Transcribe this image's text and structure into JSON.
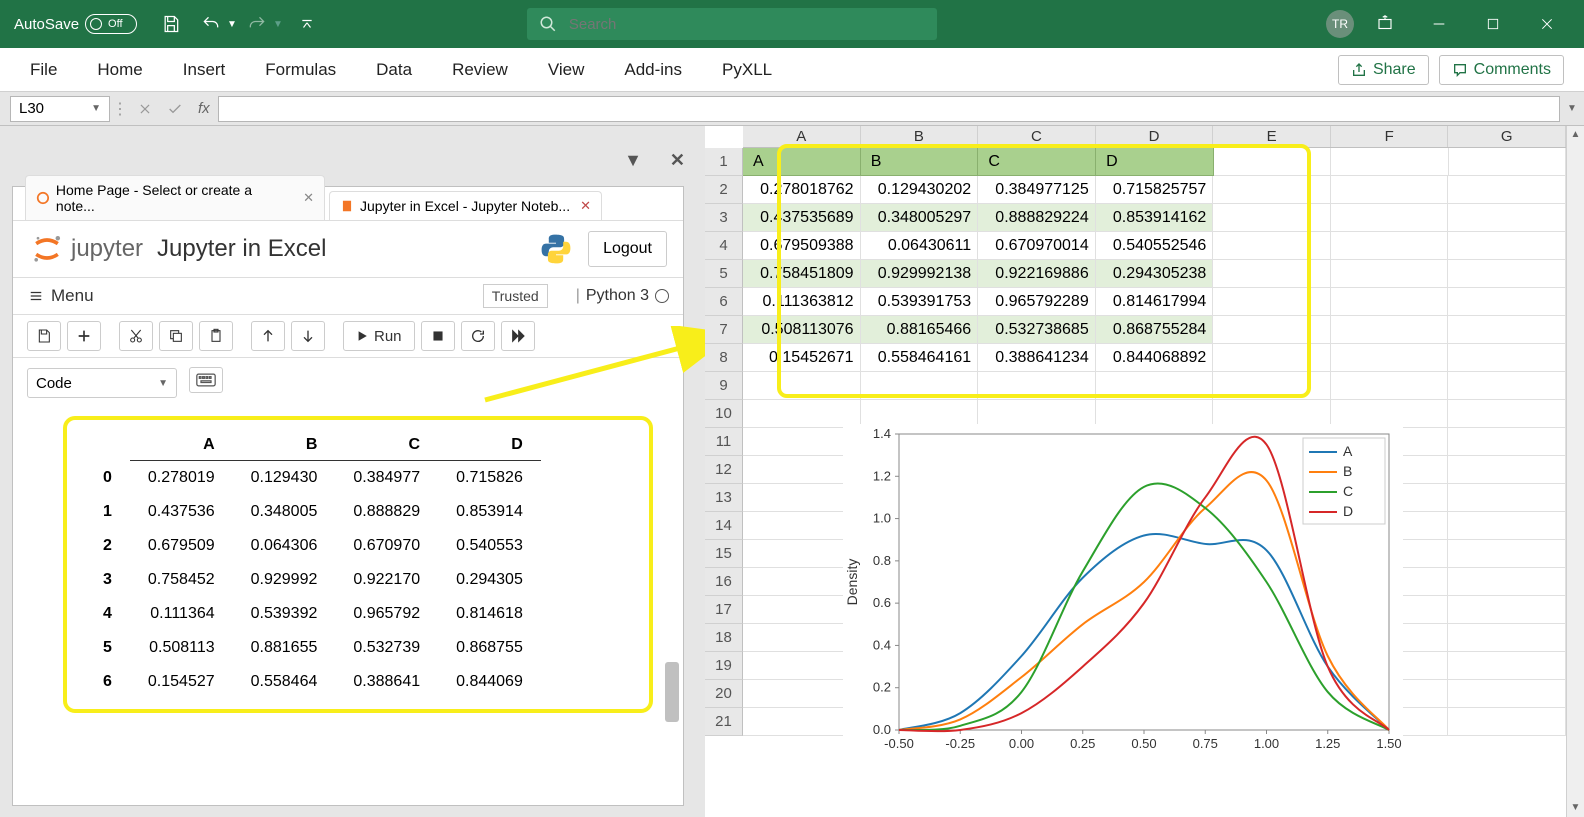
{
  "titlebar": {
    "autosave_label": "AutoSave",
    "autosave_state": "Off",
    "search_placeholder": "Search",
    "user_initials": "TR"
  },
  "ribbon": {
    "tabs": [
      "File",
      "Home",
      "Insert",
      "Formulas",
      "Data",
      "Review",
      "View",
      "Add-ins",
      "PyXLL"
    ],
    "share": "Share",
    "comments": "Comments"
  },
  "formulabar": {
    "namebox": "L30",
    "fx": "fx",
    "formula": ""
  },
  "jupyter": {
    "tab1": "Home Page - Select or create a note...",
    "tab2": "Jupyter in Excel - Jupyter Noteb...",
    "logo": "jupyter",
    "title": "Jupyter in Excel",
    "logout": "Logout",
    "menu": "Menu",
    "trusted": "Trusted",
    "kernel": "Python 3",
    "run": "Run",
    "celltype": "Code",
    "df": {
      "cols": [
        "A",
        "B",
        "C",
        "D"
      ],
      "rows": [
        {
          "i": "0",
          "v": [
            "0.278019",
            "0.129430",
            "0.384977",
            "0.715826"
          ]
        },
        {
          "i": "1",
          "v": [
            "0.437536",
            "0.348005",
            "0.888829",
            "0.853914"
          ]
        },
        {
          "i": "2",
          "v": [
            "0.679509",
            "0.064306",
            "0.670970",
            "0.540553"
          ]
        },
        {
          "i": "3",
          "v": [
            "0.758452",
            "0.929992",
            "0.922170",
            "0.294305"
          ]
        },
        {
          "i": "4",
          "v": [
            "0.111364",
            "0.539392",
            "0.965792",
            "0.814618"
          ]
        },
        {
          "i": "5",
          "v": [
            "0.508113",
            "0.881655",
            "0.532739",
            "0.868755"
          ]
        },
        {
          "i": "6",
          "v": [
            "0.154527",
            "0.558464",
            "0.388641",
            "0.844069"
          ]
        }
      ]
    }
  },
  "sheet": {
    "col_letters": [
      "A",
      "B",
      "C",
      "D",
      "E",
      "F",
      "G"
    ],
    "row_nums": [
      "1",
      "2",
      "3",
      "4",
      "5",
      "6",
      "7",
      "8",
      "9",
      "10",
      "11",
      "12",
      "13",
      "14",
      "15",
      "16",
      "17",
      "18",
      "19",
      "20",
      "21"
    ],
    "headers": [
      "A",
      "B",
      "C",
      "D"
    ],
    "rows": [
      [
        "0.278018762",
        "0.129430202",
        "0.384977125",
        "0.715825757"
      ],
      [
        "0.437535689",
        "0.348005297",
        "0.888829224",
        "0.853914162"
      ],
      [
        "0.679509388",
        "0.06430611",
        "0.670970014",
        "0.540552546"
      ],
      [
        "0.758451809",
        "0.929992138",
        "0.922169886",
        "0.294305238"
      ],
      [
        "0.111363812",
        "0.539391753",
        "0.965792289",
        "0.814617994"
      ],
      [
        "0.508113076",
        "0.88165466",
        "0.532738685",
        "0.868755284"
      ],
      [
        "0.15452671",
        "0.558464161",
        "0.388641234",
        "0.844068892"
      ]
    ]
  },
  "chart_data": {
    "type": "line",
    "title": "",
    "xlabel": "",
    "ylabel": "Density",
    "xlim": [
      -0.5,
      1.5
    ],
    "ylim": [
      0.0,
      1.4
    ],
    "xticks": [
      -0.5,
      -0.25,
      0.0,
      0.25,
      0.5,
      0.75,
      1.0,
      1.25,
      1.5
    ],
    "yticks": [
      0.0,
      0.2,
      0.4,
      0.6,
      0.8,
      1.0,
      1.2,
      1.4
    ],
    "legend_position": "upper right",
    "series": [
      {
        "name": "A",
        "color": "#1f77b4",
        "x": [
          -0.5,
          -0.25,
          0.0,
          0.25,
          0.5,
          0.75,
          1.0,
          1.25,
          1.5
        ],
        "y": [
          0.0,
          0.08,
          0.35,
          0.72,
          0.92,
          0.88,
          0.85,
          0.3,
          0.0
        ]
      },
      {
        "name": "B",
        "color": "#ff7f0e",
        "x": [
          -0.5,
          -0.25,
          0.0,
          0.25,
          0.5,
          0.75,
          1.0,
          1.25,
          1.5
        ],
        "y": [
          0.0,
          0.05,
          0.25,
          0.5,
          0.7,
          1.05,
          1.18,
          0.35,
          0.0
        ]
      },
      {
        "name": "C",
        "color": "#2ca02c",
        "x": [
          -0.5,
          -0.25,
          0.0,
          0.25,
          0.5,
          0.75,
          1.0,
          1.25,
          1.5
        ],
        "y": [
          0.0,
          0.02,
          0.18,
          0.75,
          1.15,
          1.05,
          0.7,
          0.18,
          0.0
        ]
      },
      {
        "name": "D",
        "color": "#d62728",
        "x": [
          -0.5,
          -0.25,
          0.0,
          0.25,
          0.5,
          0.75,
          1.0,
          1.25,
          1.5
        ],
        "y": [
          0.0,
          0.0,
          0.08,
          0.3,
          0.6,
          1.1,
          1.35,
          0.3,
          0.0
        ]
      }
    ]
  }
}
